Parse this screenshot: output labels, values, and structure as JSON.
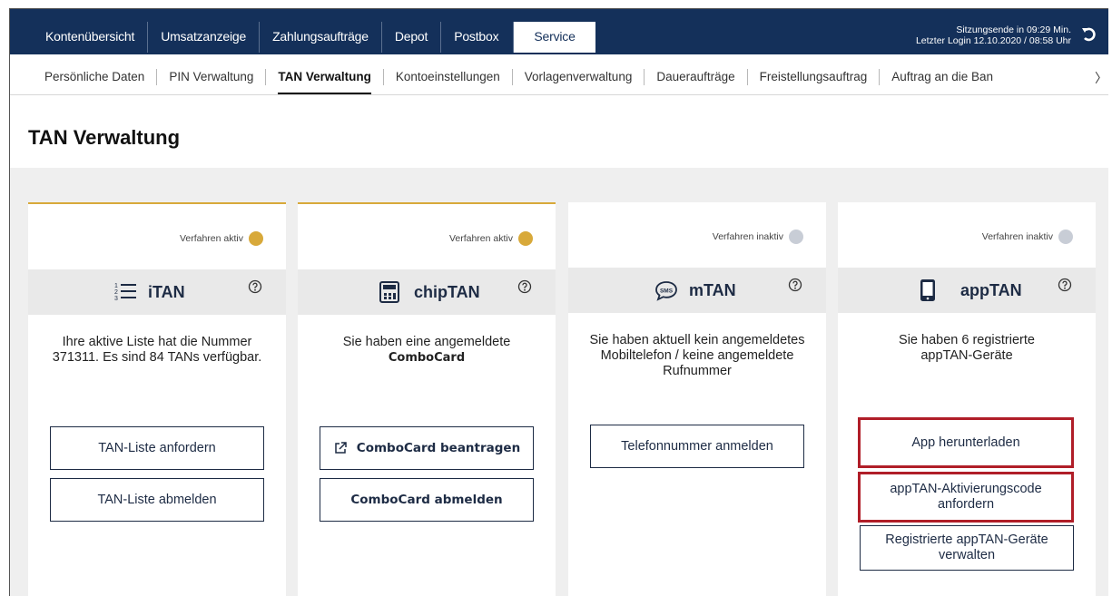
{
  "topnav": {
    "tabs": [
      {
        "label": "Kontenübersicht"
      },
      {
        "label": "Umsatzanzeige"
      },
      {
        "label": "Zahlungsaufträge"
      },
      {
        "label": "Depot"
      },
      {
        "label": "Postbox"
      },
      {
        "label": "Service"
      }
    ],
    "active": "Service",
    "session_line1": "Sitzungsende in 09:29 Min.",
    "session_line2": "Letzter Login 12.10.2020 / 08:58 Uhr"
  },
  "subnav": {
    "items": [
      {
        "label": "Persönliche Daten"
      },
      {
        "label": "PIN Verwaltung"
      },
      {
        "label": "TAN Verwaltung"
      },
      {
        "label": "Kontoeinstellungen"
      },
      {
        "label": "Vorlagenverwaltung"
      },
      {
        "label": "Daueraufträge"
      },
      {
        "label": "Freistellungsauftrag"
      },
      {
        "label": "Auftrag an die Ban"
      }
    ],
    "active": "TAN Verwaltung",
    "more_glyph": "〉"
  },
  "page": {
    "title": "TAN Verwaltung"
  },
  "colors": {
    "navy": "#14305a",
    "gold": "#d8a93a",
    "inactive_dot": "#c8cdd6",
    "highlight": "#b01e28",
    "content_bg": "#efefef"
  },
  "cards": [
    {
      "status": "Verfahren aktiv",
      "name": "iTAN",
      "icon": "numbered-list-icon",
      "description": "Ihre aktive Liste hat die Nummer 371311. Es sind 84 TANs verfügbar.",
      "buttons": [
        "TAN-Liste anfordern",
        "TAN-Liste abmelden"
      ]
    },
    {
      "status": "Verfahren aktiv",
      "name": "chipTAN",
      "icon": "calculator-icon",
      "description_line1": "Sie haben eine angemeldete",
      "description_line2": "ComboCard",
      "buttons": [
        "ComboCard beantragen",
        "ComboCard abmelden"
      ]
    },
    {
      "status": "Verfahren inaktiv",
      "name": "mTAN",
      "icon": "sms-icon",
      "description": "Sie haben aktuell kein angemeldetes Mobiltelefon / keine angemeldete Rufnummer",
      "buttons": [
        "Telefonnummer anmelden"
      ]
    },
    {
      "status": "Verfahren inaktiv",
      "name": "appTAN",
      "icon": "smartphone-icon",
      "description": "Sie haben 6 registrierte appTAN-Geräte",
      "buttons": [
        "App herunterladen",
        "appTAN-Aktivierungscode anfordern",
        "Registrierte appTAN-Geräte verwalten"
      ]
    }
  ]
}
